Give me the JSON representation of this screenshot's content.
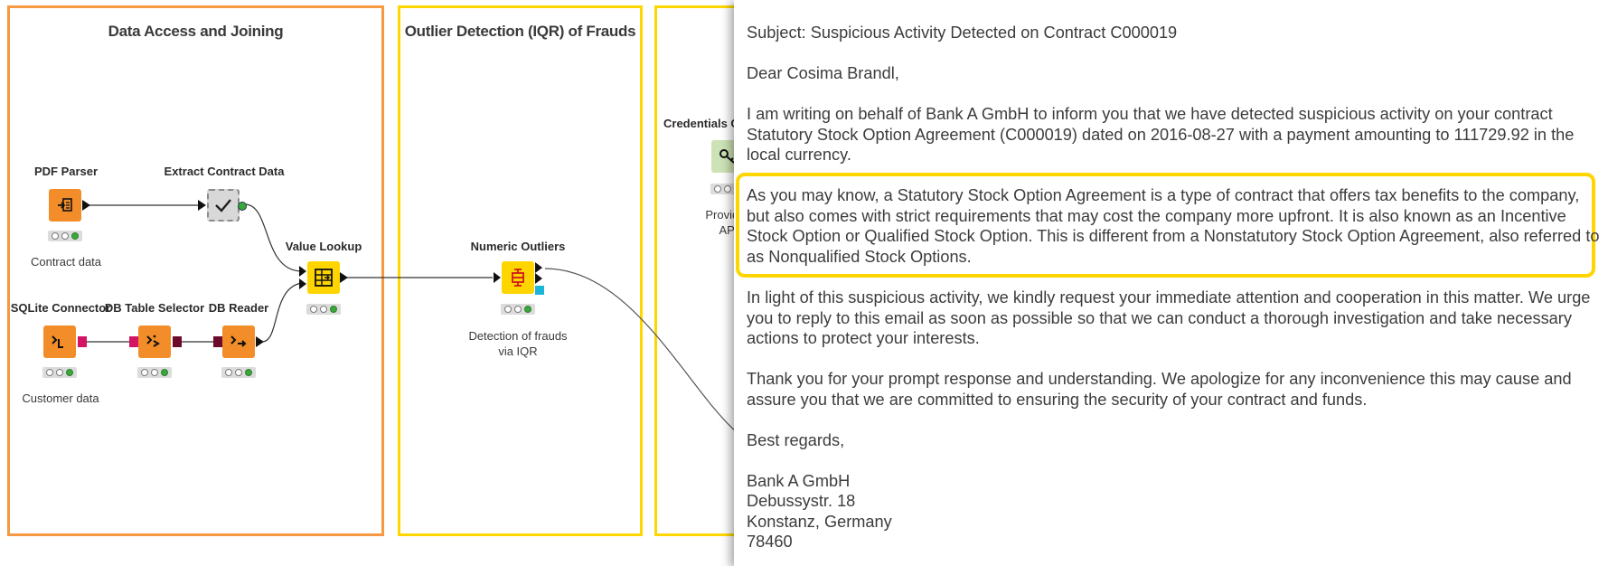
{
  "annotations": {
    "data_access": "Data Access and Joining",
    "outlier_detection": "Outlier Detection (IQR) of Frauds"
  },
  "nodes": {
    "pdf_parser": {
      "label": "PDF Parser",
      "desc": "Contract data"
    },
    "extract_contract": {
      "label": "Extract Contract Data"
    },
    "value_lookup": {
      "label": "Value Lookup"
    },
    "sqlite_connector": {
      "label": "SQLite Connector",
      "desc": "Customer data"
    },
    "db_table_selector": {
      "label": "DB Table Selector"
    },
    "db_reader": {
      "label": "DB Reader"
    },
    "numeric_outliers": {
      "label": "Numeric Outliers",
      "desc": "Detection of frauds\nvia IQR"
    },
    "credentials": {
      "label": "Credentials Co",
      "desc": "Provide t\nAPI"
    }
  },
  "colors": {
    "orange_annotation": "#f59a43",
    "yellow_annotation": "#ffd700",
    "node_orange": "#f28d2a",
    "node_yellow": "#ffd500",
    "highlight": "#ffd500",
    "status_green": "#39a839"
  },
  "email": {
    "subject": "Subject: Suspicious Activity Detected on Contract C000019",
    "greeting": "Dear Cosima Brandl,",
    "p1": "I am writing on behalf of Bank A GmbH to inform you that we have detected suspicious activity on your contract Statutory Stock Option Agreement (C000019) dated on 2016-08-27 with a payment amounting to 111729.92 in the local currency.",
    "p2": "As you may know, a Statutory Stock Option Agreement is a type of contract that offers tax benefits to the company, but also comes with strict requirements that may cost the company more upfront. It is also known as an Incentive Stock Option or Qualified Stock Option. This is different from a Nonstatutory Stock Option Agreement, also referred to as Nonqualified Stock Options.",
    "p3": "In light of this suspicious activity, we kindly request your immediate attention and cooperation in this matter. We urge you to reply to this email as soon as possible so that we can conduct a thorough investigation and take necessary actions to protect your interests.",
    "p4": "Thank you for your prompt response and understanding. We apologize for any inconvenience this may cause and assure you that we are committed to ensuring the security of your contract and funds.",
    "closing": "Best regards,",
    "sig_company": "Bank A GmbH",
    "sig_street": "Debussystr. 18",
    "sig_city": "Konstanz, Germany",
    "sig_zip": "78460"
  }
}
